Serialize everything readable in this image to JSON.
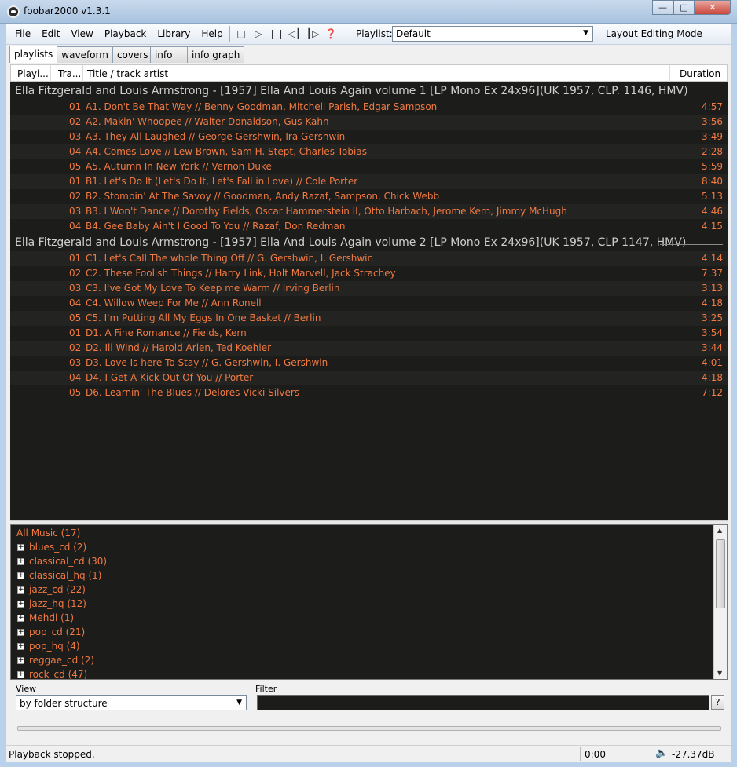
{
  "window": {
    "title": "foobar2000 v1.3.1"
  },
  "menu": [
    "File",
    "Edit",
    "View",
    "Playback",
    "Library",
    "Help"
  ],
  "playlist_selector": {
    "label": "Playlist:",
    "value": "Default"
  },
  "layout_mode_label": "Layout Editing Mode",
  "tabs": [
    "playlists",
    "waveform",
    "covers",
    "info",
    "info graph"
  ],
  "columns": {
    "playing": "Playi...",
    "track": "Tra...",
    "title": "Title / track artist",
    "duration": "Duration"
  },
  "groups": [
    {
      "header": "Ella Fitzgerald and Louis Armstrong - [1957] Ella And Louis Again volume 1 [LP Mono Ex 24x96](UK 1957, CLP. 1146, HMV)",
      "tracks": [
        {
          "num": "01",
          "title": "A1. Don't Be That Way // Benny Goodman, Mitchell Parish, Edgar Sampson",
          "dur": "4:57"
        },
        {
          "num": "02",
          "title": "A2. Makin' Whoopee // Walter Donaldson, Gus Kahn",
          "dur": "3:56"
        },
        {
          "num": "03",
          "title": "A3. They All Laughed // George Gershwin, Ira Gershwin",
          "dur": "3:49"
        },
        {
          "num": "04",
          "title": "A4. Comes Love // Lew Brown, Sam H. Stept, Charles Tobias",
          "dur": "2:28"
        },
        {
          "num": "05",
          "title": "A5. Autumn In New York // Vernon Duke",
          "dur": "5:59"
        },
        {
          "num": "01",
          "title": "B1. Let's Do It (Let's Do It, Let's Fall in Love) // Cole Porter",
          "dur": "8:40"
        },
        {
          "num": "02",
          "title": "B2. Stompin' At The Savoy // Goodman, Andy Razaf, Sampson, Chick Webb",
          "dur": "5:13"
        },
        {
          "num": "03",
          "title": "B3. I Won't Dance // Dorothy Fields, Oscar Hammerstein II, Otto Harbach, Jerome Kern, Jimmy McHugh",
          "dur": "4:46"
        },
        {
          "num": "04",
          "title": "B4. Gee Baby Ain't I Good To You // Razaf, Don Redman",
          "dur": "4:15"
        }
      ]
    },
    {
      "header": "Ella Fitzgerald and Louis Armstrong - [1957] Ella And Louis Again volume 2 [LP Mono Ex 24x96](UK 1957, CLP 1147, HMV)",
      "tracks": [
        {
          "num": "01",
          "title": "C1. Let's Call The whole Thing Off // G. Gershwin, I. Gershwin",
          "dur": "4:14"
        },
        {
          "num": "02",
          "title": "C2. These Foolish Things // Harry Link, Holt Marvell, Jack Strachey",
          "dur": "7:37"
        },
        {
          "num": "03",
          "title": "C3. I've Got My Love To Keep me Warm // Irving Berlin",
          "dur": "3:13"
        },
        {
          "num": "04",
          "title": "C4. Willow Weep For Me // Ann Ronell",
          "dur": "4:18"
        },
        {
          "num": "05",
          "title": "C5. I'm Putting All My Eggs In One Basket // Berlin",
          "dur": "3:25"
        },
        {
          "num": "01",
          "title": "D1. A Fine Romance // Fields, Kern",
          "dur": "3:54"
        },
        {
          "num": "02",
          "title": "D2. Ill Wind // Harold Arlen, Ted Koehler",
          "dur": "3:44"
        },
        {
          "num": "03",
          "title": "D3. Love Is here To Stay // G. Gershwin, I. Gershwin",
          "dur": "4:01"
        },
        {
          "num": "04",
          "title": "D4. I Get A Kick Out Of You // Porter",
          "dur": "4:18"
        },
        {
          "num": "05",
          "title": "D6. Learnin' The Blues // Delores Vicki Silvers",
          "dur": "7:12"
        }
      ]
    }
  ],
  "library": {
    "root": "All Music (17)",
    "items": [
      "blues_cd (2)",
      "classical_cd (30)",
      "classical_hq (1)",
      "jazz_cd (22)",
      "jazz_hq (12)",
      "Mehdi (1)",
      "pop_cd (21)",
      "pop_hq (4)",
      "reggae_cd (2)",
      "rock_cd (47)"
    ]
  },
  "view": {
    "label": "View",
    "value": "by folder structure"
  },
  "filter": {
    "label": "Filter",
    "value": "",
    "help": "?"
  },
  "status": {
    "message": "Playback stopped.",
    "time": "0:00",
    "volume": "-27.37dB"
  },
  "colors": {
    "accent": "#f07a42",
    "list_bg": "#1c1c1b",
    "group_text": "#cfcfcf"
  }
}
